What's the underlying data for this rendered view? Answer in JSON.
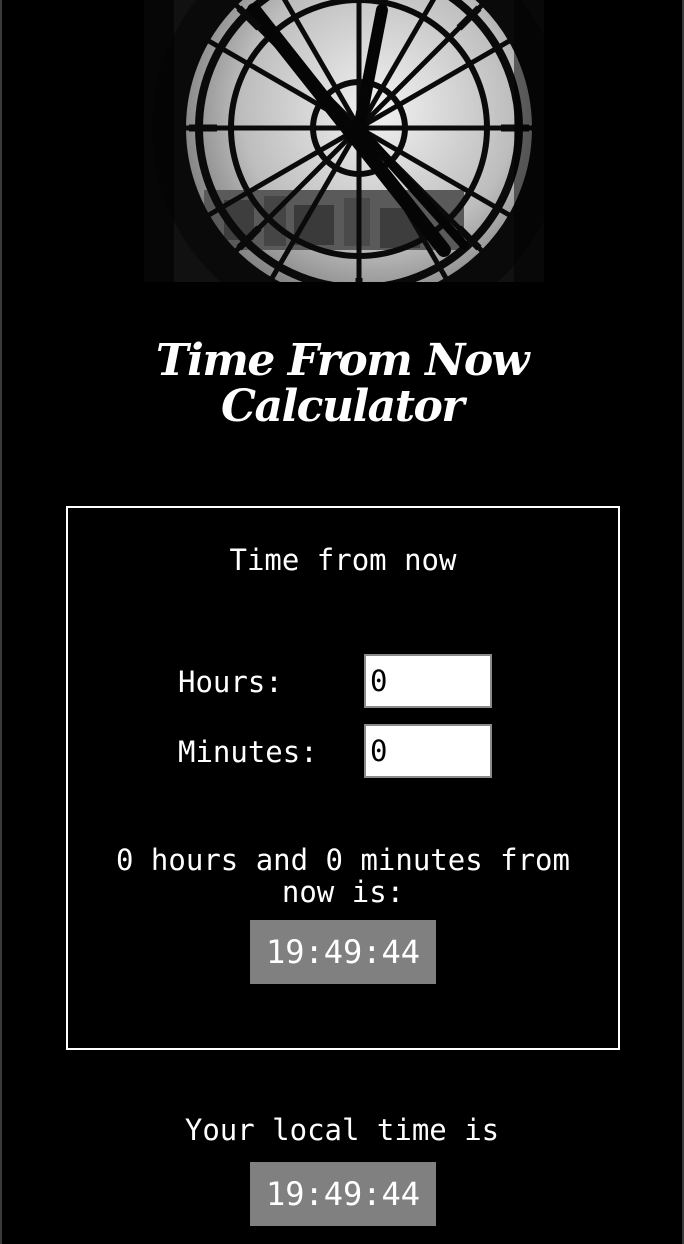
{
  "header": {
    "title_line1": "Time From Now",
    "title_line2": "Calculator"
  },
  "calculator": {
    "heading": "Time from now",
    "hours_label": "Hours:",
    "hours_value": "0",
    "minutes_label": "Minutes:",
    "minutes_value": "0",
    "result_line1": "0 hours and 0 minutes from",
    "result_line2": "now is:",
    "result_time": "19:49:44"
  },
  "local": {
    "label": "Your local time is",
    "time": "19:49:44"
  }
}
